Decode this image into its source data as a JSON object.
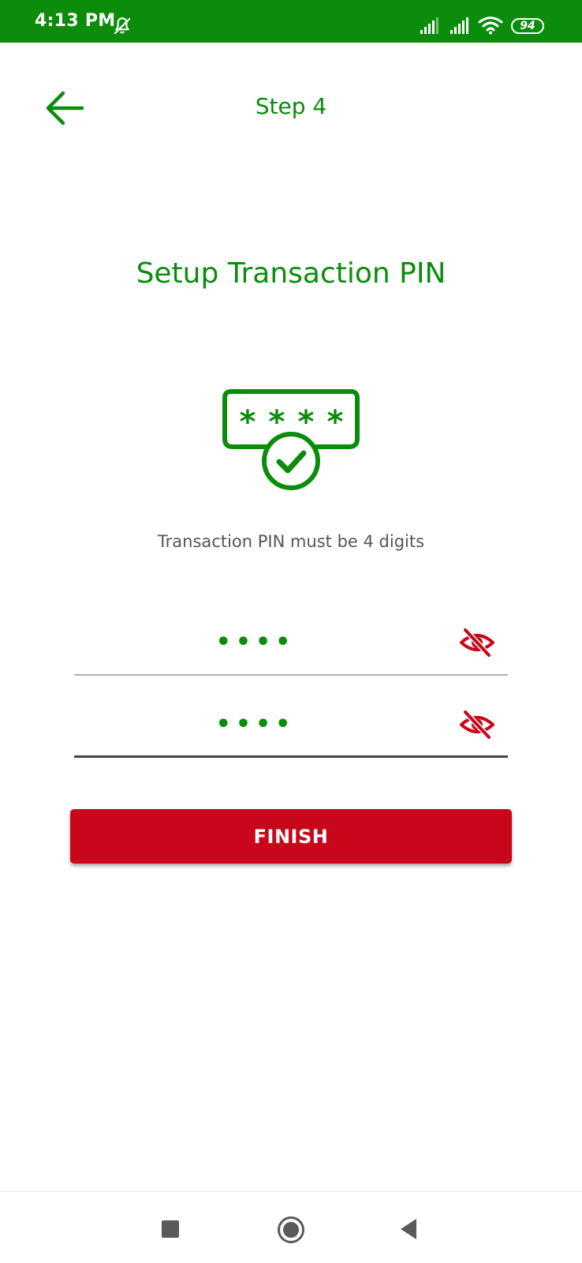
{
  "status_bar": {
    "time": "4:13 PM",
    "battery": "94",
    "background_color": "#0b8c0b",
    "icons": [
      "mute-notifications-icon",
      "signal-icon",
      "signal-icon",
      "wifi-icon",
      "battery-icon"
    ]
  },
  "header": {
    "title": "Step 4",
    "back_icon": "arrow-left-icon"
  },
  "main": {
    "title": "Setup Transaction PIN",
    "illustration_icon": "pin-check-icon",
    "hint": "Transaction PIN must be 4 digits",
    "pin_field": {
      "value": "••••",
      "toggle_icon": "eye-off-icon"
    },
    "confirm_pin_field": {
      "value": "••••",
      "toggle_icon": "eye-off-icon"
    },
    "finish_label": "FINISH"
  },
  "colors": {
    "primary_green": "#0b8c0b",
    "accent_red": "#c8081a"
  },
  "nav_bar": {
    "icons": [
      "recent-apps-icon",
      "home-icon",
      "back-icon"
    ]
  }
}
